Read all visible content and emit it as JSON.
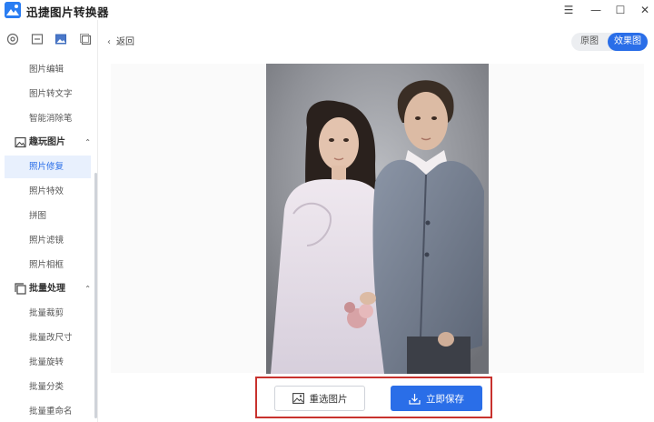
{
  "app": {
    "title": "迅捷图片转换器"
  },
  "window_controls": {
    "menu": "☰",
    "minimize": "—",
    "maximize": "☐",
    "close": "✕"
  },
  "sidebar": {
    "top_icons": [
      "settings-icon",
      "photo-edit-icon",
      "image-icon",
      "layers-icon"
    ],
    "items_top": [
      "图片编辑",
      "图片转文字",
      "智能消除笔"
    ],
    "group_fun": {
      "label": "趣玩图片",
      "items": [
        "照片修复",
        "照片特效",
        "拼图",
        "照片滤镜",
        "照片相框"
      ],
      "active": "照片修复"
    },
    "group_batch": {
      "label": "批量处理",
      "items": [
        "批量裁剪",
        "批量改尺寸",
        "批量旋转",
        "批量分类",
        "批量重命名"
      ]
    }
  },
  "header": {
    "back_label": "返回"
  },
  "view_toggle": {
    "original": "原图",
    "result": "效果图",
    "selected": "效果图"
  },
  "actions": {
    "reselect_label": "重选图片",
    "save_label": "立即保存"
  },
  "colors": {
    "accent": "#2a6ee8",
    "highlight_border": "#c8322e"
  }
}
